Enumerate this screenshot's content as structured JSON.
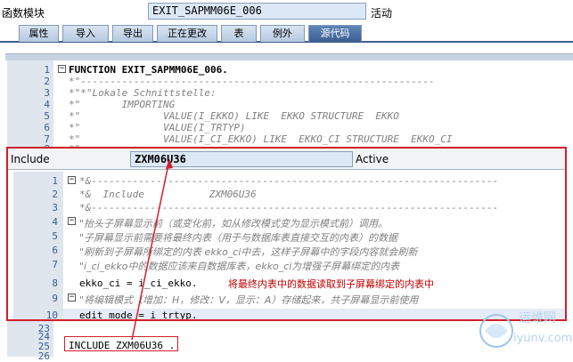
{
  "header": {
    "label": "函数模块",
    "module_name": "EXIT_SAPMM06E_006",
    "status": "活动"
  },
  "tabs": [
    {
      "label": "属性"
    },
    {
      "label": "导入"
    },
    {
      "label": "导出"
    },
    {
      "label": "正在更改"
    },
    {
      "label": "表"
    },
    {
      "label": "例外"
    },
    {
      "label": "源代码"
    }
  ],
  "editor": {
    "lines": [
      {
        "num": "1",
        "text": "FUNCTION EXIT_SAPMM06E_006.",
        "style": "kw"
      },
      {
        "num": "2",
        "text": "*\"------------------------------------------------------------",
        "style": "cm"
      },
      {
        "num": "3",
        "text": "*\"*\"Lokale Schnittstelle:",
        "style": "cm"
      },
      {
        "num": "4",
        "text": "*\"       IMPORTING",
        "style": "cm"
      },
      {
        "num": "5",
        "text": "*\"              VALUE(I_EKKO) LIKE  EKKO STRUCTURE  EKKO",
        "style": "cm"
      },
      {
        "num": "6",
        "text": "*\"              VALUE(I_TRTYP)",
        "style": "cm"
      },
      {
        "num": "7",
        "text": "*\"              VALUE(I_CI_EKKO) LIKE  EKKO_CI STRUCTURE  EKKO_CI",
        "style": "cm"
      },
      {
        "num": "8",
        "text": "*\"",
        "style": "cm"
      }
    ],
    "lower_lines": [
      {
        "num": "23",
        "text": ""
      },
      {
        "num": "24",
        "text": ""
      },
      {
        "num": "25",
        "text": "INCLUDE ZXM06U36 ."
      },
      {
        "num": "26",
        "text": ""
      }
    ]
  },
  "popup": {
    "label": "Include",
    "include_name": "ZXM06U36",
    "status": "Active",
    "lines": [
      {
        "num": "1",
        "text": "*&---------------------------------------------------------------------",
        "style": "cm"
      },
      {
        "num": "2",
        "text": "*&  Include           ZXM06U36",
        "style": "cm"
      },
      {
        "num": "3",
        "text": "*&---------------------------------------------------------------------",
        "style": "cm"
      },
      {
        "num": "4",
        "text": "\"抬头子屏幕显示前（或变化前，如从修改模式变为显示模式前）调用。",
        "style": "cm cn"
      },
      {
        "num": "5",
        "text": "\"子屏幕显示前需要将最终内表（用于与数据库表直接交互的内表）的数据",
        "style": "cm cn"
      },
      {
        "num": "6",
        "text": "\"刷新到子屏幕所绑定的内表 ekko_ci中去，这样子屏幕中的字段内容就会刷新",
        "style": "cm cn"
      },
      {
        "num": "7",
        "text": "\"i_ci_ekko中的数据应该来自数据库表，ekko_ci为增强子屏幕绑定的内表",
        "style": "cm cn"
      },
      {
        "num": "8",
        "text": "ekko_ci = i_ci_ekko.",
        "style": "plain"
      },
      {
        "num": "9",
        "text": "\"将编辑模式（增加：H，修改：V，显示：A）存储起来，共子屏幕显示前使用",
        "style": "cm cn"
      },
      {
        "num": "10",
        "text": "edit_mode = i_trtyp.",
        "style": "plain"
      }
    ],
    "annotation": "将最终内表中的数据读取到子屏幕绑定的内表中"
  },
  "watermark": {
    "cn": "运维网",
    "url": "iyunv.com"
  },
  "colors": {
    "accent": "#3c5f92",
    "annotation": "#c00000",
    "frame": "#d0202a"
  }
}
